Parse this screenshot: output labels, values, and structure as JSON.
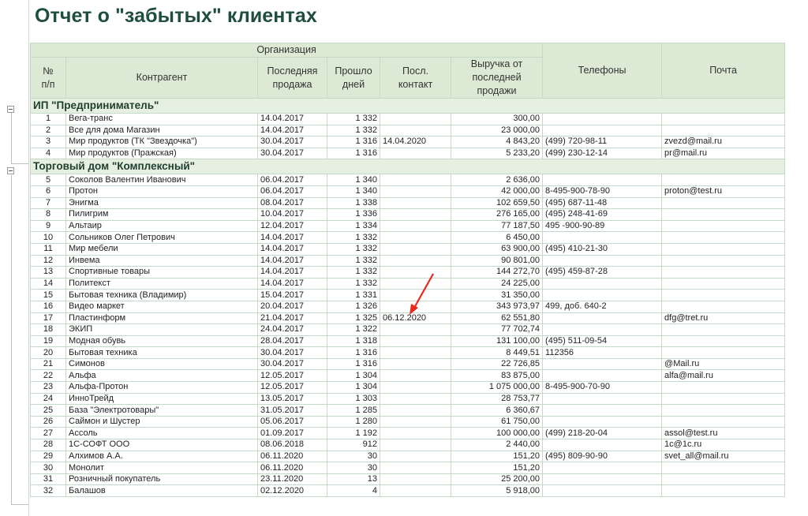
{
  "report": {
    "title": "Отчет о \"забытых\" клиентах",
    "header": {
      "org_group": "Организация",
      "num": "№\nп/п",
      "contractor": "Контрагент",
      "last_sale": "Последняя\nпродажа",
      "days": "Прошло\nдней",
      "last_contact": "Посл.\nконтакт",
      "revenue": "Выручка от\nпоследней\nпродажи",
      "phones": "Телефоны",
      "email": "Почта"
    },
    "groups": [
      {
        "name": "ИП \"Предприниматель\"",
        "rows": [
          {
            "n": "1",
            "name": "Вега-транс",
            "date": "14.04.2017",
            "days": "1 332",
            "contact": "",
            "rev": "300,00",
            "phone": "",
            "email": ""
          },
          {
            "n": "2",
            "name": "Все для дома Магазин",
            "date": "14.04.2017",
            "days": "1 332",
            "contact": "",
            "rev": "23 000,00",
            "phone": "",
            "email": ""
          },
          {
            "n": "3",
            "name": "Мир продуктов (ТК \"Звездочка\")",
            "date": "30.04.2017",
            "days": "1 316",
            "contact": "14.04.2020",
            "rev": "4 843,20",
            "phone": "(499) 720-98-11",
            "email": "zvezd@mail.ru"
          },
          {
            "n": "4",
            "name": "Мир продуктов (Пражская)",
            "date": "30.04.2017",
            "days": "1 316",
            "contact": "",
            "rev": "5 233,20",
            "phone": "(499) 230-12-14",
            "email": "pr@mail.ru"
          }
        ]
      },
      {
        "name": "Торговый дом \"Комплексный\"",
        "rows": [
          {
            "n": "5",
            "name": "Соколов Валентин Иванович",
            "date": "06.04.2017",
            "days": "1 340",
            "contact": "",
            "rev": "2 636,00",
            "phone": "",
            "email": ""
          },
          {
            "n": "6",
            "name": "Протон",
            "date": "06.04.2017",
            "days": "1 340",
            "contact": "",
            "rev": "42 000,00",
            "phone": "8-495-900-78-90",
            "email": "proton@test.ru"
          },
          {
            "n": "7",
            "name": "Энигма",
            "date": "08.04.2017",
            "days": "1 338",
            "contact": "",
            "rev": "102 659,50",
            "phone": "(495) 687-11-48",
            "email": ""
          },
          {
            "n": "8",
            "name": "Пилигрим",
            "date": "10.04.2017",
            "days": "1 336",
            "contact": "",
            "rev": "276 165,00",
            "phone": "(495) 248-41-69",
            "email": ""
          },
          {
            "n": "9",
            "name": "Альтаир",
            "date": "12.04.2017",
            "days": "1 334",
            "contact": "",
            "rev": "77 187,50",
            "phone": "495 -900-90-89",
            "email": ""
          },
          {
            "n": "10",
            "name": "Сольников Олег Петрович",
            "date": "14.04.2017",
            "days": "1 332",
            "contact": "",
            "rev": "6 450,00",
            "phone": "",
            "email": ""
          },
          {
            "n": "11",
            "name": "Мир мебели",
            "date": "14.04.2017",
            "days": "1 332",
            "contact": "",
            "rev": "63 900,00",
            "phone": "(495) 410-21-30",
            "email": ""
          },
          {
            "n": "12",
            "name": "Инвема",
            "date": "14.04.2017",
            "days": "1 332",
            "contact": "",
            "rev": "90 801,00",
            "phone": "",
            "email": ""
          },
          {
            "n": "13",
            "name": "Спортивные товары",
            "date": "14.04.2017",
            "days": "1 332",
            "contact": "",
            "rev": "144 272,70",
            "phone": "(495) 459-87-28",
            "email": ""
          },
          {
            "n": "14",
            "name": "Политекст",
            "date": "14.04.2017",
            "days": "1 332",
            "contact": "",
            "rev": "24 225,00",
            "phone": "",
            "email": ""
          },
          {
            "n": "15",
            "name": "Бытовая техника (Владимир)",
            "date": "15.04.2017",
            "days": "1 331",
            "contact": "",
            "rev": "31 350,00",
            "phone": "",
            "email": ""
          },
          {
            "n": "16",
            "name": "Видео маркет",
            "date": "20.04.2017",
            "days": "1 326",
            "contact": "",
            "rev": "343 973,97",
            "phone": "499, доб. 640-2",
            "email": ""
          },
          {
            "n": "17",
            "name": "Пластинформ",
            "date": "21.04.2017",
            "days": "1 325",
            "contact": "06.12.2020",
            "rev": "62 551,80",
            "phone": "",
            "email": "dfg@tret.ru"
          },
          {
            "n": "18",
            "name": "ЭКИП",
            "date": "24.04.2017",
            "days": "1 322",
            "contact": "",
            "rev": "77 702,74",
            "phone": "",
            "email": ""
          },
          {
            "n": "19",
            "name": "Модная обувь",
            "date": "28.04.2017",
            "days": "1 318",
            "contact": "",
            "rev": "131 100,00",
            "phone": "(495) 511-09-54",
            "email": ""
          },
          {
            "n": "20",
            "name": "Бытовая техника",
            "date": "30.04.2017",
            "days": "1 316",
            "contact": "",
            "rev": "8 449,51",
            "phone": "112356",
            "email": ""
          },
          {
            "n": "21",
            "name": "Симонов",
            "date": "30.04.2017",
            "days": "1 316",
            "contact": "",
            "rev": "22 726,85",
            "phone": "",
            "email": "@Mail.ru"
          },
          {
            "n": "22",
            "name": "Альфа",
            "date": "12.05.2017",
            "days": "1 304",
            "contact": "",
            "rev": "83 875,00",
            "phone": "",
            "email": "alfa@mail.ru"
          },
          {
            "n": "23",
            "name": "Альфа-Протон",
            "date": "12.05.2017",
            "days": "1 304",
            "contact": "",
            "rev": "1 075 000,00",
            "phone": "8-495-900-70-90",
            "email": ""
          },
          {
            "n": "24",
            "name": "ИнноТрейд",
            "date": "13.05.2017",
            "days": "1 303",
            "contact": "",
            "rev": "28 753,77",
            "phone": "",
            "email": ""
          },
          {
            "n": "25",
            "name": "База \"Электротовары\"",
            "date": "31.05.2017",
            "days": "1 285",
            "contact": "",
            "rev": "6 360,67",
            "phone": "",
            "email": ""
          },
          {
            "n": "26",
            "name": "Саймон и Шустер",
            "date": "05.06.2017",
            "days": "1 280",
            "contact": "",
            "rev": "61 750,00",
            "phone": "",
            "email": ""
          },
          {
            "n": "27",
            "name": "Ассоль",
            "date": "01.09.2017",
            "days": "1 192",
            "contact": "",
            "rev": "100 000,00",
            "phone": "(499) 218-20-04",
            "email": "assol@test.ru"
          },
          {
            "n": "28",
            "name": "1С-СОФТ ООО",
            "date": "08.06.2018",
            "days": "912",
            "contact": "",
            "rev": "2 440,00",
            "phone": "",
            "email": "1c@1c.ru"
          },
          {
            "n": "29",
            "name": "Алхимов А.А.",
            "date": "06.11.2020",
            "days": "30",
            "contact": "",
            "rev": "151,20",
            "phone": "(495) 809-90-90",
            "email": "svet_all@mail.ru"
          },
          {
            "n": "30",
            "name": "Монолит",
            "date": "06.11.2020",
            "days": "30",
            "contact": "",
            "rev": "151,20",
            "phone": "",
            "email": ""
          },
          {
            "n": "31",
            "name": "Розничный покупатель",
            "date": "23.11.2020",
            "days": "13",
            "contact": "",
            "rev": "25 200,00",
            "phone": "",
            "email": ""
          },
          {
            "n": "32",
            "name": "Балашов",
            "date": "02.12.2020",
            "days": "4",
            "contact": "",
            "rev": "5 918,00",
            "phone": "",
            "email": ""
          }
        ]
      }
    ]
  },
  "annotation": {
    "arrow_color": "#e8281e"
  },
  "icons": {
    "collapse_toggle": "minus-box-icon"
  }
}
